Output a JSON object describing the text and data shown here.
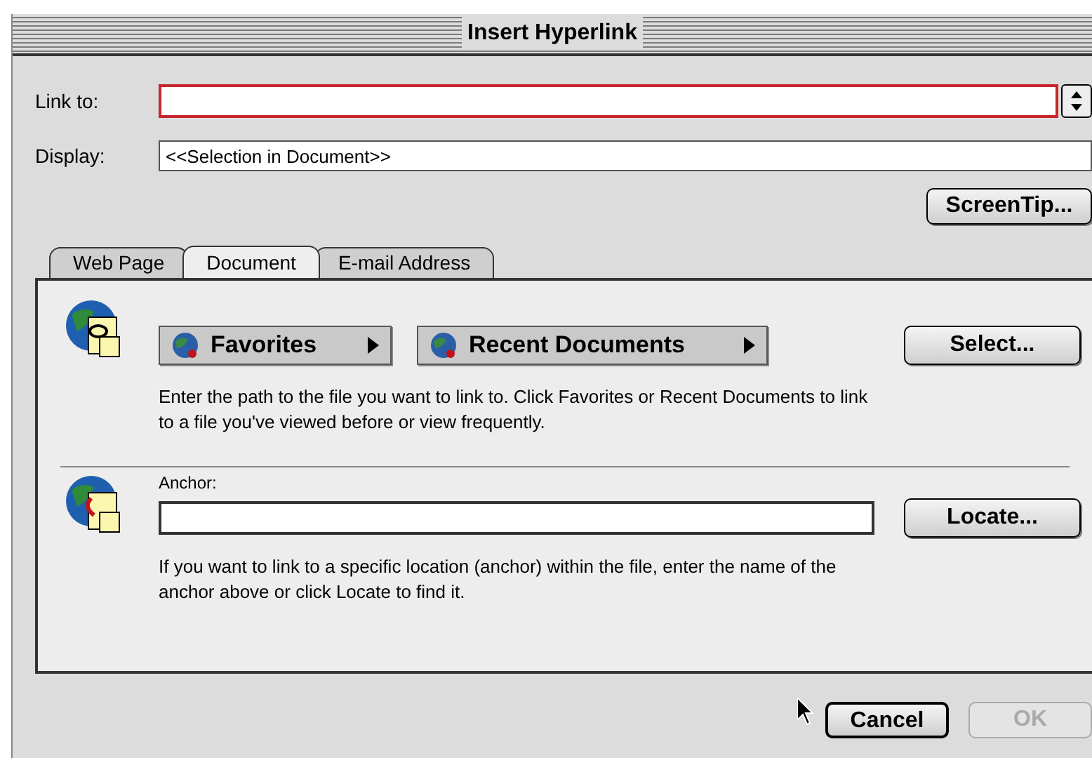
{
  "window": {
    "title": "Insert Hyperlink"
  },
  "link_to": {
    "label": "Link to:",
    "focused": true
  },
  "display": {
    "label": "Display:",
    "value": "<<Selection in Document>>"
  },
  "screentip_button": "ScreenTip...",
  "tabs": [
    {
      "label": "Web Page",
      "selected": false
    },
    {
      "label": "Document",
      "selected": true
    },
    {
      "label": "E-mail Address",
      "selected": false
    }
  ],
  "document_panel": {
    "menus": [
      "Favorites",
      "Recent Documents"
    ],
    "select_button": "Select...",
    "help": "Enter the path to the file you want to link to. Click Favorites or Recent Documents to link to a file you've viewed before or view frequently.",
    "anchor_label": "Anchor:",
    "locate_button": "Locate...",
    "anchor_help": "If you want to link to a specific location (anchor) within the file, enter the name of the anchor above or click Locate to find it."
  },
  "buttons": [
    {
      "label": "Cancel",
      "disabled": false
    },
    {
      "label": "OK",
      "disabled": true
    }
  ]
}
